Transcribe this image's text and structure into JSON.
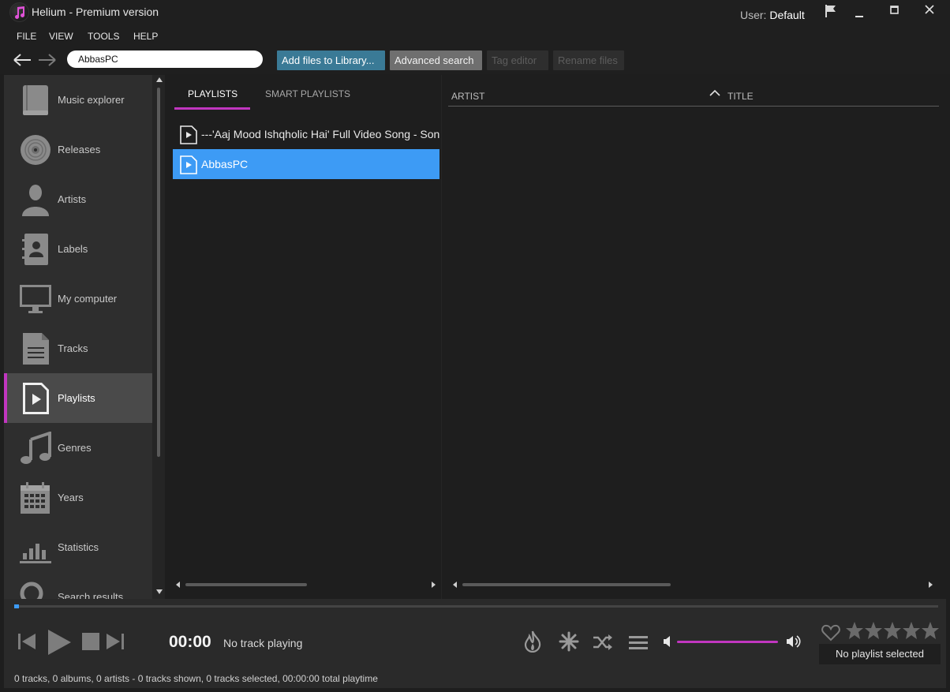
{
  "window": {
    "title": "Helium - Premium version",
    "user_prefix": "User:",
    "user_name": "Default"
  },
  "menu": [
    "FILE",
    "VIEW",
    "TOOLS",
    "HELP"
  ],
  "toolbar": {
    "search_value": "AbbasPC",
    "add_files_label": "Add files to Library...",
    "advanced_search_label": "Advanced search",
    "tag_editor_label": "Tag editor",
    "rename_files_label": "Rename files"
  },
  "sidebar": {
    "items": [
      {
        "label": "Music explorer",
        "icon": "book-icon"
      },
      {
        "label": "Releases",
        "icon": "disc-icon"
      },
      {
        "label": "Artists",
        "icon": "person-icon"
      },
      {
        "label": "Labels",
        "icon": "contact-book-icon"
      },
      {
        "label": "My computer",
        "icon": "monitor-icon"
      },
      {
        "label": "Tracks",
        "icon": "document-icon"
      },
      {
        "label": "Playlists",
        "icon": "playlist-icon",
        "active": true
      },
      {
        "label": "Genres",
        "icon": "music-note-icon"
      },
      {
        "label": "Years",
        "icon": "calendar-icon"
      },
      {
        "label": "Statistics",
        "icon": "bar-chart-icon"
      },
      {
        "label": "Search results",
        "icon": "search-icon"
      }
    ]
  },
  "playlists": {
    "tabs": [
      "PLAYLISTS",
      "SMART PLAYLISTS"
    ],
    "active_tab": "PLAYLISTS",
    "items": [
      {
        "label": "---'Aaj Mood Ishqholic Hai' Full Video Song - Sonakshi Sinha",
        "selected": false
      },
      {
        "label": "AbbasPC",
        "selected": true
      }
    ]
  },
  "tracks": {
    "columns": [
      "ARTIST",
      "TITLE"
    ],
    "sort_column": "TITLE",
    "sort_direction": "ascending",
    "rows": []
  },
  "player": {
    "time": "00:00",
    "status": "No track playing",
    "rating_text": "No playlist selected",
    "rating": 0,
    "max_rating": 5,
    "volume": 1.0,
    "progress": 0
  },
  "statusbar": {
    "text": "0 tracks, 0 albums, 0 artists - 0 tracks shown, 0 tracks selected, 00:00:00 total playtime"
  },
  "colors": {
    "accent": "#c136c0",
    "selection": "#3d9bf5",
    "primary_button": "#3a7a96"
  }
}
